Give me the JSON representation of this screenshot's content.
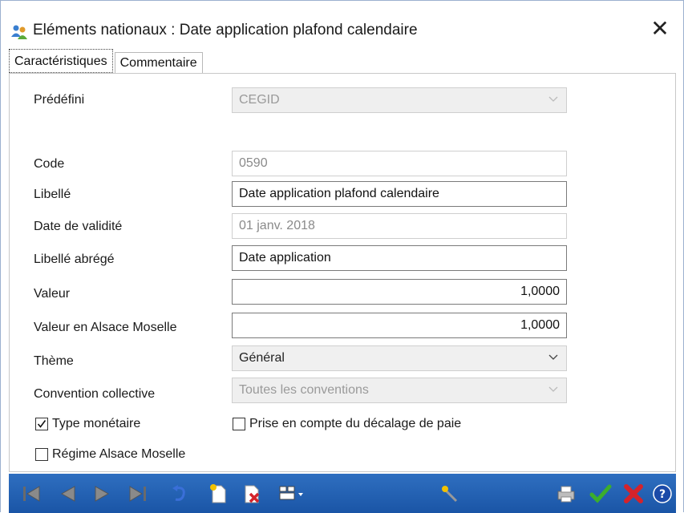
{
  "window": {
    "title": "Eléments nationaux : Date application plafond calendaire",
    "icon": "users-icon",
    "close_glyph": "✕"
  },
  "tabs": [
    {
      "label": "Caractéristiques",
      "active": true
    },
    {
      "label": "Commentaire",
      "active": false
    }
  ],
  "form": {
    "predefini": {
      "label": "Prédéfini",
      "value": "CEGID"
    },
    "code": {
      "label": "Code",
      "value": "0590"
    },
    "libelle": {
      "label": "Libellé",
      "value": "Date application plafond calendaire"
    },
    "date_validite": {
      "label": "Date de validité",
      "value": "01 janv. 2018"
    },
    "libelle_abrege": {
      "label": "Libellé abrégé",
      "value": "Date application"
    },
    "valeur": {
      "label": "Valeur",
      "value": "1,0000"
    },
    "valeur_alsace": {
      "label": "Valeur en Alsace Moselle",
      "value": "1,0000"
    },
    "theme": {
      "label": "Thème",
      "value": "Général"
    },
    "convention": {
      "label": "Convention collective",
      "value": "Toutes les conventions"
    },
    "type_monetaire": {
      "label": "Type monétaire",
      "checked": true
    },
    "prise_en_compte": {
      "label": "Prise en compte du décalage de paie",
      "checked": false
    },
    "regime_alsace": {
      "label": "Régime Alsace Moselle",
      "checked": false
    }
  },
  "toolbar": {
    "buttons": [
      "first-icon",
      "previous-icon",
      "next-icon",
      "last-icon",
      "undo-icon",
      "new-icon",
      "delete-icon",
      "form-menu-icon",
      "magic-icon",
      "print-icon",
      "validate-icon",
      "cancel-icon",
      "help-icon"
    ]
  },
  "colors": {
    "toolbar_bg": "#1f5db0",
    "validate": "#3cae2c",
    "cancel": "#d4232b",
    "help": "#1b4aa8"
  }
}
